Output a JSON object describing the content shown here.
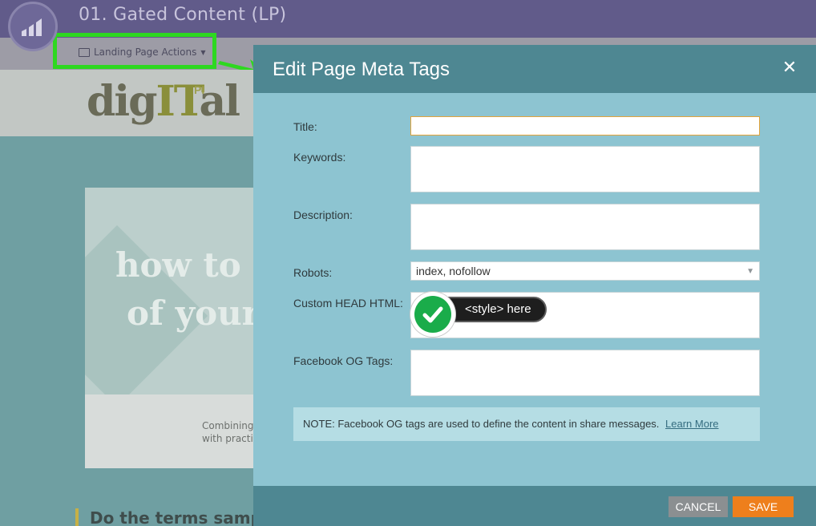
{
  "app": {
    "title": "01. Gated Content (LP)",
    "actions_label": "Landing Page Actions"
  },
  "background": {
    "brand": {
      "prefix": "dig",
      "highlight": "IT",
      "suffix": "al",
      "badge": "PI"
    },
    "hero_line1": "how to r",
    "hero_line2": "of your",
    "hero_caption1": "Combining",
    "hero_caption2": "with practic",
    "question": "Do the terms samp"
  },
  "modal": {
    "title": "Edit Page Meta Tags",
    "fields": {
      "title_label": "Title:",
      "title_value": "",
      "keywords_label": "Keywords:",
      "keywords_value": "",
      "description_label": "Description:",
      "description_value": "",
      "robots_label": "Robots:",
      "robots_value": "index, nofollow",
      "custom_head_label": "Custom HEAD HTML:",
      "custom_head_value": "",
      "og_label": "Facebook OG Tags:",
      "og_value": ""
    },
    "note": {
      "text": "NOTE:  Facebook OG tags are used to define the content in share messages.",
      "link": "Learn More"
    },
    "annotation": "<style> here",
    "buttons": {
      "cancel": "CANCEL",
      "save": "SAVE"
    }
  },
  "colors": {
    "topbar": "#615b8a",
    "modal_header": "#4e8792",
    "modal_body": "#8dc4d1",
    "highlight": "#2ed820",
    "save": "#ee7f1c",
    "check": "#1aac4a"
  },
  "icons": [
    "marketo-logo-icon",
    "page-icon",
    "chevron-down-icon",
    "close-icon",
    "check-icon",
    "arrow-icon"
  ]
}
